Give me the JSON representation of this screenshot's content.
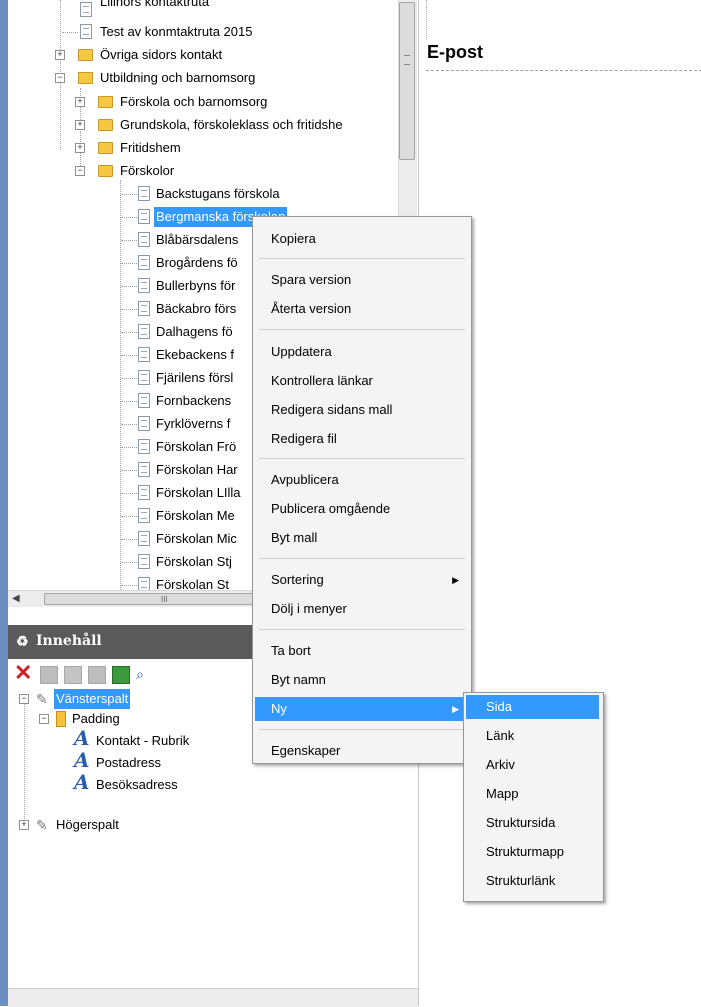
{
  "site_tree": {
    "items": [
      {
        "label": "Lillnors kontaktruta"
      },
      {
        "label": "Test av konmtaktruta 2015"
      },
      {
        "label": "Övriga sidors kontakt"
      },
      {
        "label": "Utbildning och barnomsorg"
      },
      {
        "label": "Förskola och barnomsorg"
      },
      {
        "label": "Grundskola, förskoleklass och fritidshe"
      },
      {
        "label": "Fritidshem"
      },
      {
        "label": "Förskolor"
      },
      {
        "label": "Backstugans förskola"
      },
      {
        "label": "Bergmanska förskolan"
      },
      {
        "label": "Blåbärsdalens"
      },
      {
        "label": "Brogårdens fö"
      },
      {
        "label": "Bullerbyns för"
      },
      {
        "label": "Bäckabro förs"
      },
      {
        "label": "Dalhagens fö"
      },
      {
        "label": "Ekebackens f"
      },
      {
        "label": "Fjärilens försl"
      },
      {
        "label": "Fornbackens"
      },
      {
        "label": "Fyrklöverns f"
      },
      {
        "label": "Förskolan Frö"
      },
      {
        "label": "Förskolan Har"
      },
      {
        "label": "Förskolan LIlla"
      },
      {
        "label": "Förskolan Me"
      },
      {
        "label": "Förskolan Mic"
      },
      {
        "label": "Förskolan Stj"
      },
      {
        "label": "Förskolan St"
      }
    ],
    "scroll_grip": "III"
  },
  "content_panel": {
    "title": "Innehåll",
    "tree": {
      "items": [
        {
          "label": "Vänsterspalt"
        },
        {
          "label": "Padding"
        },
        {
          "label": "Kontakt - Rubrik"
        },
        {
          "label": "Postadress"
        },
        {
          "label": "Besöksadress"
        },
        {
          "label": "Högerspalt"
        }
      ]
    }
  },
  "preview": {
    "heading": "E-post"
  },
  "context_menu": {
    "items": [
      {
        "label": "Kopiera"
      },
      {
        "label": "Spara version"
      },
      {
        "label": "Återta version"
      },
      {
        "label": "Uppdatera"
      },
      {
        "label": "Kontrollera länkar"
      },
      {
        "label": "Redigera sidans mall"
      },
      {
        "label": "Redigera fil"
      },
      {
        "label": "Avpublicera"
      },
      {
        "label": "Publicera omgående"
      },
      {
        "label": "Byt mall"
      },
      {
        "label": "Sortering"
      },
      {
        "label": "Dölj i menyer"
      },
      {
        "label": "Ta bort"
      },
      {
        "label": "Byt namn"
      },
      {
        "label": "Ny"
      },
      {
        "label": "Egenskaper"
      }
    ]
  },
  "submenu": {
    "items": [
      {
        "label": "Sida"
      },
      {
        "label": "Länk"
      },
      {
        "label": "Arkiv"
      },
      {
        "label": "Mapp"
      },
      {
        "label": "Struktursida"
      },
      {
        "label": "Strukturmapp"
      },
      {
        "label": "Strukturlänk"
      }
    ]
  },
  "colors": {
    "selection": "#3399ff",
    "folder": "#f5c842",
    "panel_header": "#5a5a5a",
    "delete": "#cc2222"
  }
}
